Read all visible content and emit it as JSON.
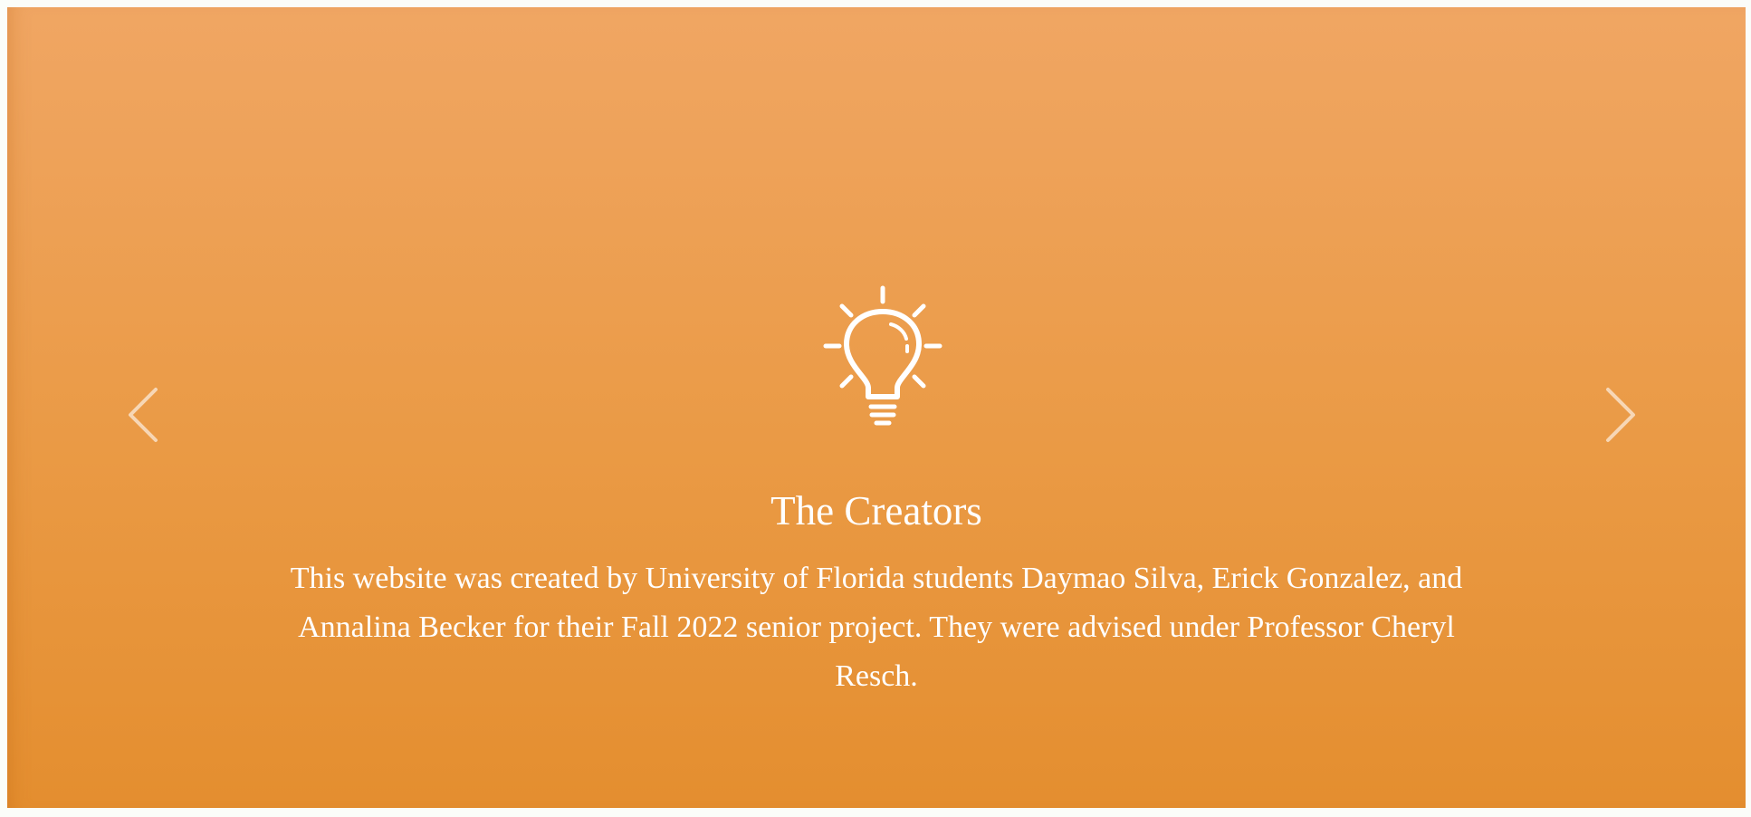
{
  "carousel": {
    "slide": {
      "icon": "lightbulb-icon",
      "title": "The Creators",
      "text": "This website was created by University of Florida students Daymao Silva, Erick Gonzalez, and Annalina Becker for their Fall 2022 senior project. They were advised under Professor Cheryl Resch."
    },
    "prev_icon": "chevron-left-icon",
    "next_icon": "chevron-right-icon"
  },
  "colors": {
    "gradient_top": "#f0a663",
    "gradient_bottom": "#e48e2f",
    "text": "#ffffff"
  }
}
